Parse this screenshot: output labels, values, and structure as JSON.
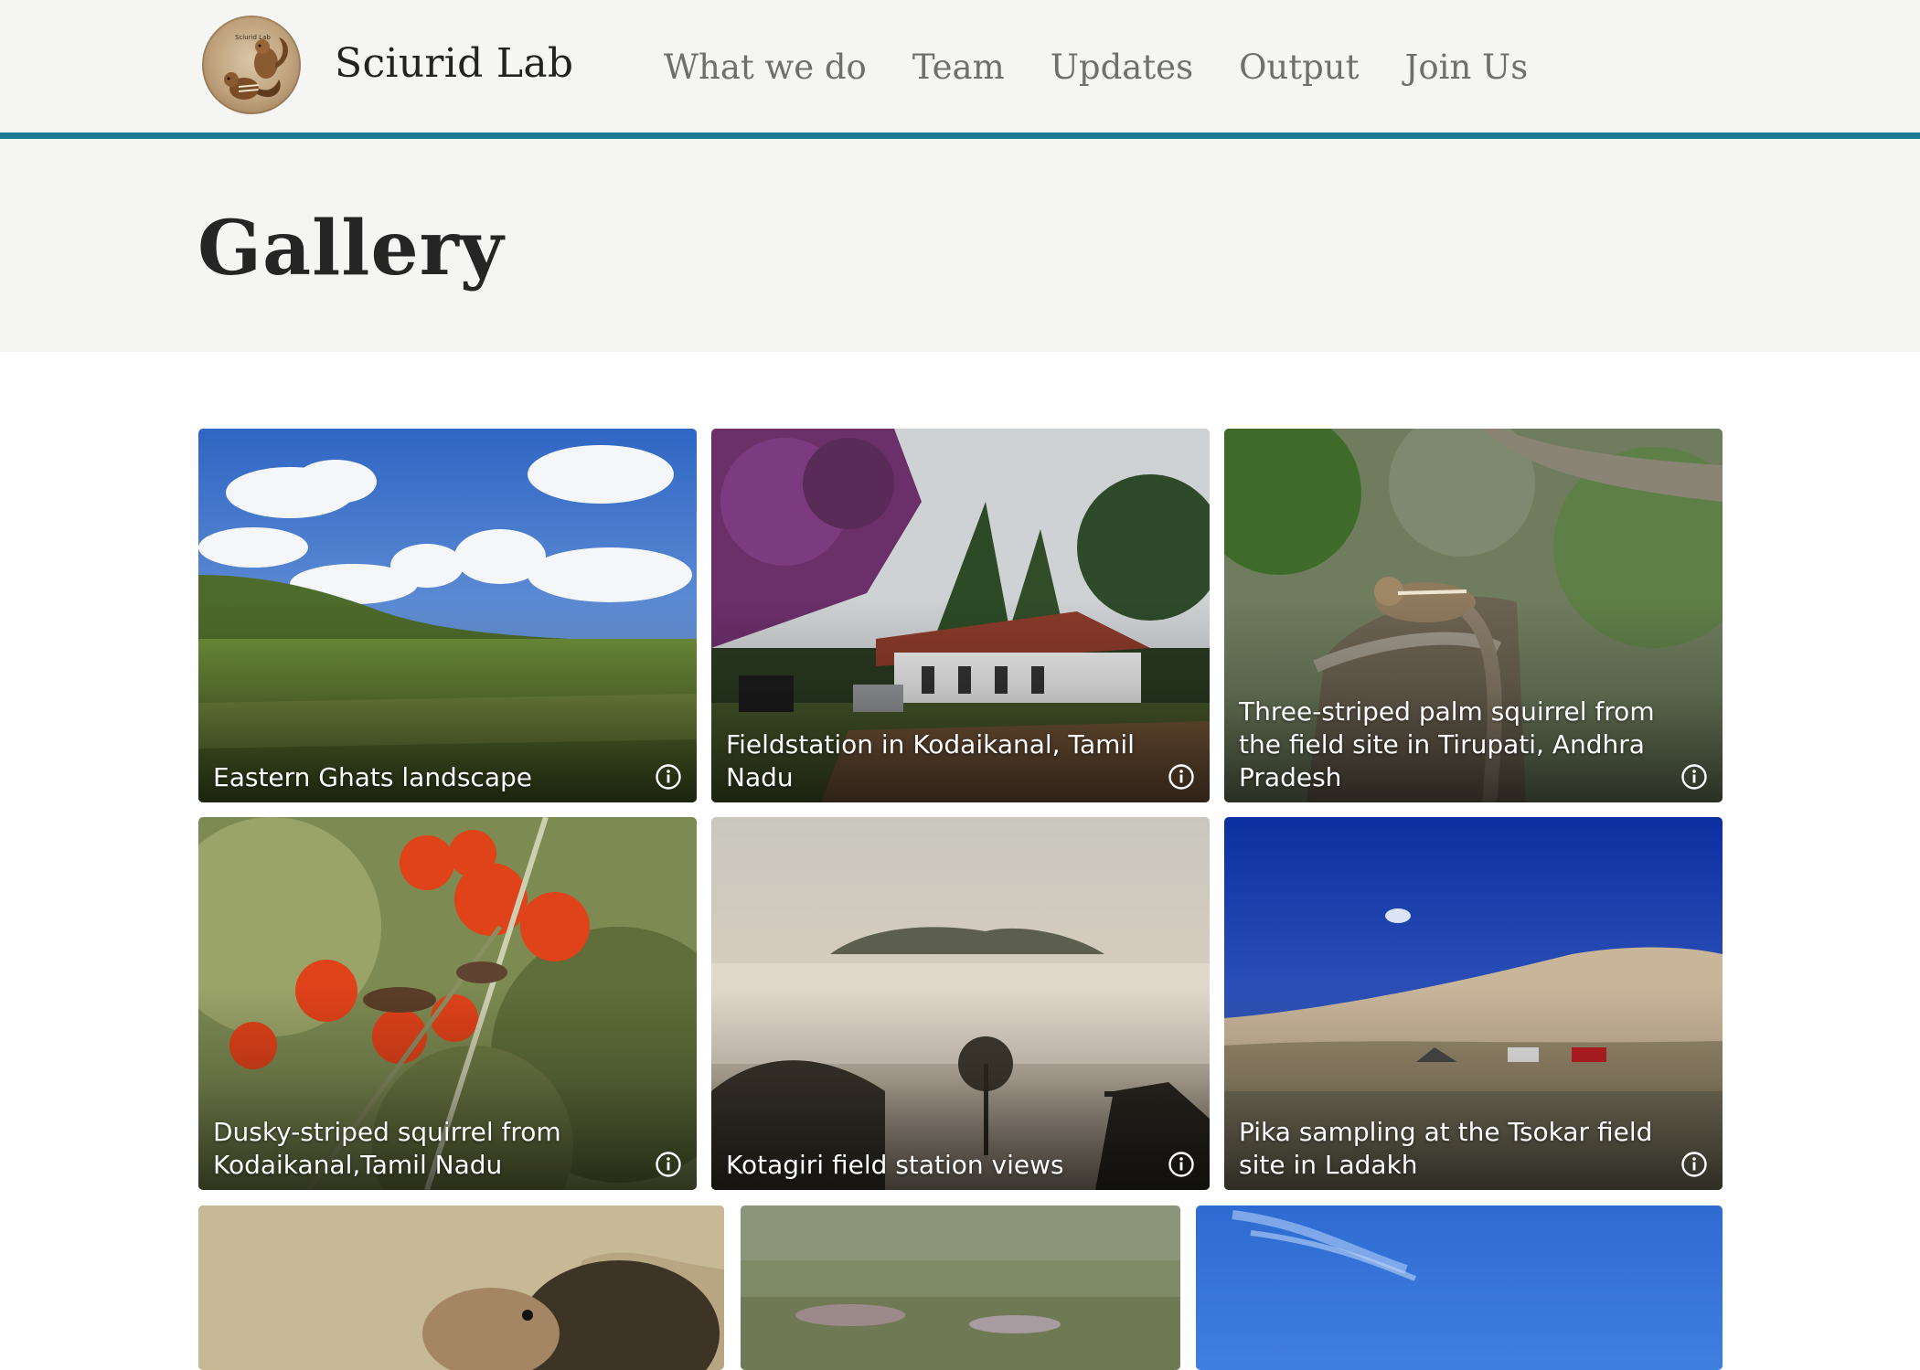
{
  "site": {
    "title": "Sciurid Lab",
    "logo_text": "Sciurid Lab"
  },
  "nav": {
    "items": [
      "What we do",
      "Team",
      "Updates",
      "Output",
      "Join Us"
    ]
  },
  "page": {
    "title": "Gallery"
  },
  "gallery": {
    "items": [
      {
        "caption": "Eastern Ghats landscape",
        "icon": "info-icon"
      },
      {
        "caption": "Fieldstation in Kodaikanal, Tamil Nadu",
        "icon": "info-icon"
      },
      {
        "caption": "Three-striped palm squirrel from the field site in Tirupati, Andhra Pradesh",
        "icon": "info-icon"
      },
      {
        "caption": "Dusky-striped squirrel from Kodaikanal,Tamil Nadu",
        "icon": "info-icon"
      },
      {
        "caption": "Kotagiri field station views",
        "icon": "info-icon"
      },
      {
        "caption": "Pika sampling at the Tsokar field site in Ladakh",
        "icon": "info-icon"
      }
    ]
  },
  "colors": {
    "accent": "#1a7a92",
    "header_bg": "#f5f5f3",
    "nav_text": "#6f6f6f",
    "title_text": "#252525"
  }
}
